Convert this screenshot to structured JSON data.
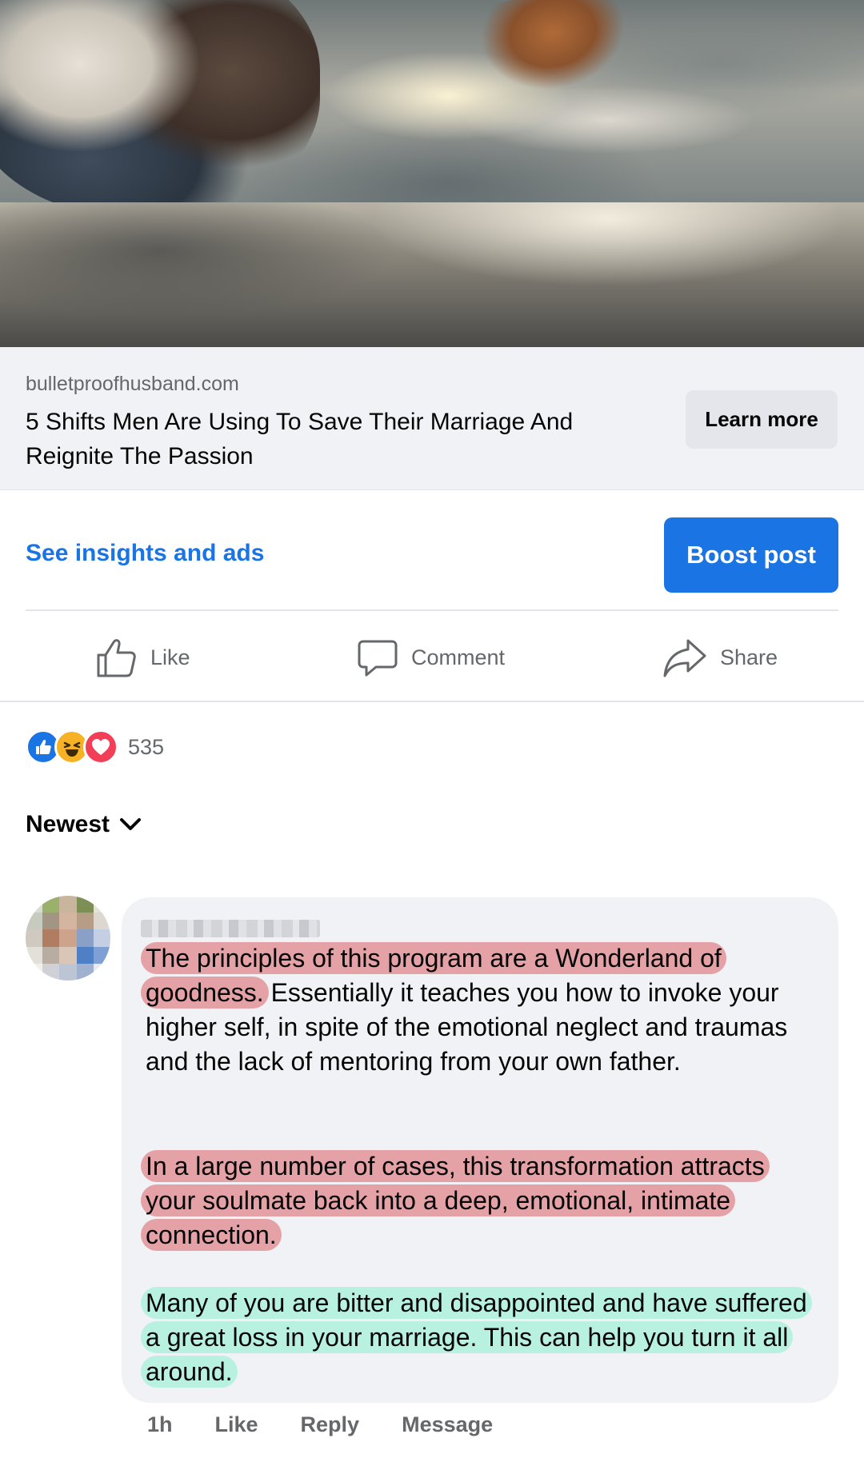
{
  "post": {
    "link": {
      "domain": "bulletproofhusband.com",
      "title": "5 Shifts Men Are Using To Save Their Marriage And Reignite The Passion",
      "cta_label": "Learn more"
    },
    "insights_label": "See insights and ads",
    "boost_label": "Boost post",
    "actions": {
      "like": "Like",
      "comment": "Comment",
      "share": "Share"
    },
    "reactions": {
      "types": [
        "like",
        "haha",
        "love"
      ],
      "count": "535"
    },
    "sort_label": "Newest"
  },
  "comment": {
    "para1_highlight": "The principles of this program are a Wonderland of goodness.",
    "para1_rest": " Essentially it teaches you how to invoke your higher self, in spite of the emotional neglect and traumas and the lack of mentoring from your own father.",
    "para2_highlight": "In a large number of cases, this transformation attracts your soulmate back into a deep, emotional, intimate connection.",
    "para3_highlight": "Many of you are bitter and disappointed and have suffered a great loss in your marriage. This can help you turn it all around.",
    "highlight_colors": {
      "red": "#de7b80",
      "green": "#96f0d2"
    },
    "meta": {
      "time": "1h",
      "like": "Like",
      "reply": "Reply",
      "message": "Message"
    }
  },
  "colors": {
    "accent": "#1b74e4",
    "secondary_text": "#65676b",
    "surface": "#f0f2f5"
  }
}
